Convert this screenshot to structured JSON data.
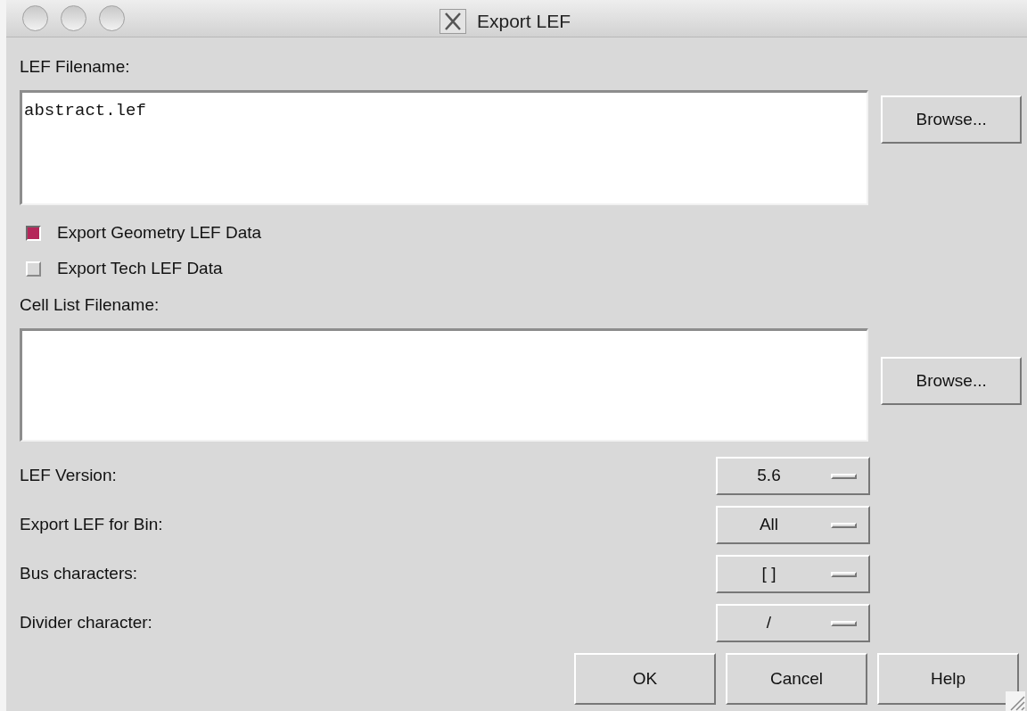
{
  "window": {
    "title": "Export LEF"
  },
  "lef_filename": {
    "label": "LEF Filename:",
    "value": "abstract.lef",
    "button": "Browse..."
  },
  "checkboxes": [
    {
      "label": "Export Geometry LEF Data",
      "checked": true
    },
    {
      "label": "Export Tech LEF Data",
      "checked": false
    }
  ],
  "cell_list_filename": {
    "label": "Cell List Filename:",
    "button": "Browse..."
  },
  "options": [
    {
      "label": "LEF Version:",
      "value": "5.6"
    },
    {
      "label": "Export LEF for Bin:",
      "value": "All"
    },
    {
      "label": "Bus characters:",
      "value": "[ ]"
    },
    {
      "label": "Divider character:",
      "value": "/"
    }
  ],
  "buttons": [
    "OK",
    "Cancel",
    "Help"
  ]
}
